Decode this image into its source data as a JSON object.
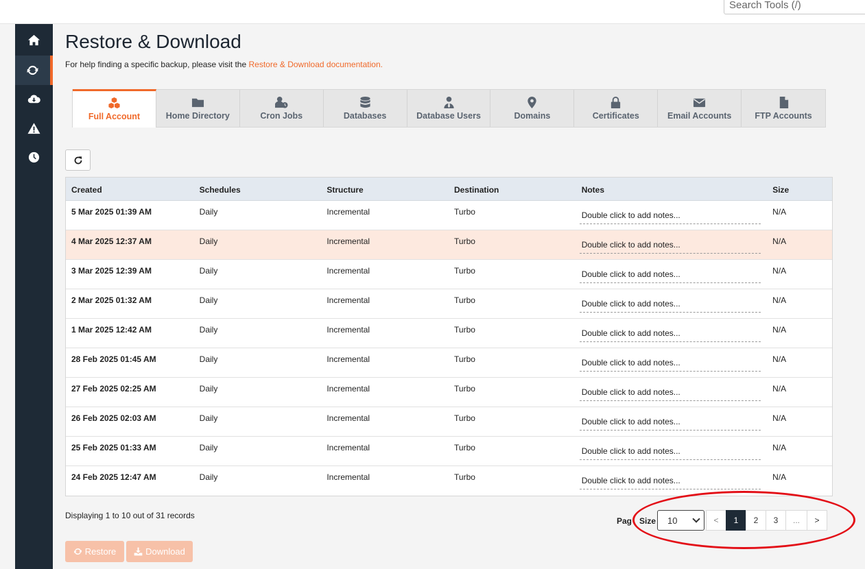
{
  "search": {
    "placeholder": "Search Tools (/)"
  },
  "sidebar": {
    "items": [
      {
        "icon": "home-icon",
        "active": false
      },
      {
        "icon": "refresh-icon",
        "active": true
      },
      {
        "icon": "cloud-download-icon",
        "active": false
      },
      {
        "icon": "warning-icon",
        "active": false
      },
      {
        "icon": "clock-icon",
        "active": false
      }
    ]
  },
  "page": {
    "title": "Restore & Download",
    "help_text": "For help finding a specific backup, please visit the",
    "help_link": "Restore & Download documentation."
  },
  "tabs": [
    {
      "label": "Full Account",
      "icon": "cubes-icon",
      "active": true
    },
    {
      "label": "Home Directory",
      "icon": "folder-icon"
    },
    {
      "label": "Cron Jobs",
      "icon": "user-clock-icon"
    },
    {
      "label": "Databases",
      "icon": "database-icon"
    },
    {
      "label": "Database Users",
      "icon": "user-tie-icon"
    },
    {
      "label": "Domains",
      "icon": "map-marker-icon"
    },
    {
      "label": "Certificates",
      "icon": "lock-icon"
    },
    {
      "label": "Email Accounts",
      "icon": "envelope-icon"
    },
    {
      "label": "FTP Accounts",
      "icon": "file-icon"
    }
  ],
  "table": {
    "headers": [
      "Created",
      "Schedules",
      "Structure",
      "Destination",
      "Notes",
      "Size"
    ],
    "rows": [
      {
        "created": "5 Mar 2025 01:39 AM",
        "schedule": "Daily",
        "structure": "Incremental",
        "destination": "Turbo",
        "notes": "Double click to add notes...",
        "size": "N/A"
      },
      {
        "created": "4 Mar 2025 12:37 AM",
        "schedule": "Daily",
        "structure": "Incremental",
        "destination": "Turbo",
        "notes": "Double click to add notes...",
        "size": "N/A"
      },
      {
        "created": "3 Mar 2025 12:39 AM",
        "schedule": "Daily",
        "structure": "Incremental",
        "destination": "Turbo",
        "notes": "Double click to add notes...",
        "size": "N/A"
      },
      {
        "created": "2 Mar 2025 01:32 AM",
        "schedule": "Daily",
        "structure": "Incremental",
        "destination": "Turbo",
        "notes": "Double click to add notes...",
        "size": "N/A"
      },
      {
        "created": "1 Mar 2025 12:42 AM",
        "schedule": "Daily",
        "structure": "Incremental",
        "destination": "Turbo",
        "notes": "Double click to add notes...",
        "size": "N/A"
      },
      {
        "created": "28 Feb 2025 01:45 AM",
        "schedule": "Daily",
        "structure": "Incremental",
        "destination": "Turbo",
        "notes": "Double click to add notes...",
        "size": "N/A"
      },
      {
        "created": "27 Feb 2025 02:25 AM",
        "schedule": "Daily",
        "structure": "Incremental",
        "destination": "Turbo",
        "notes": "Double click to add notes...",
        "size": "N/A"
      },
      {
        "created": "26 Feb 2025 02:03 AM",
        "schedule": "Daily",
        "structure": "Incremental",
        "destination": "Turbo",
        "notes": "Double click to add notes...",
        "size": "N/A"
      },
      {
        "created": "25 Feb 2025 01:33 AM",
        "schedule": "Daily",
        "structure": "Incremental",
        "destination": "Turbo",
        "notes": "Double click to add notes...",
        "size": "N/A"
      },
      {
        "created": "24 Feb 2025 12:47 AM",
        "schedule": "Daily",
        "structure": "Incremental",
        "destination": "Turbo",
        "notes": "Double click to add notes...",
        "size": "N/A"
      }
    ],
    "highlighted_row": 1
  },
  "footer": {
    "records": "Displaying 1 to 10 out of 31 records",
    "page_label": "Pag",
    "size_label": "Size",
    "size_value": "10",
    "pages": [
      "<",
      "1",
      "2",
      "3",
      "...",
      ">"
    ],
    "current_page": "1"
  },
  "actions": {
    "restore": "Restore",
    "download": "Download"
  },
  "colors": {
    "accent": "#f0692a",
    "sidebar": "#1e2a36",
    "annotation": "#e30f17"
  }
}
